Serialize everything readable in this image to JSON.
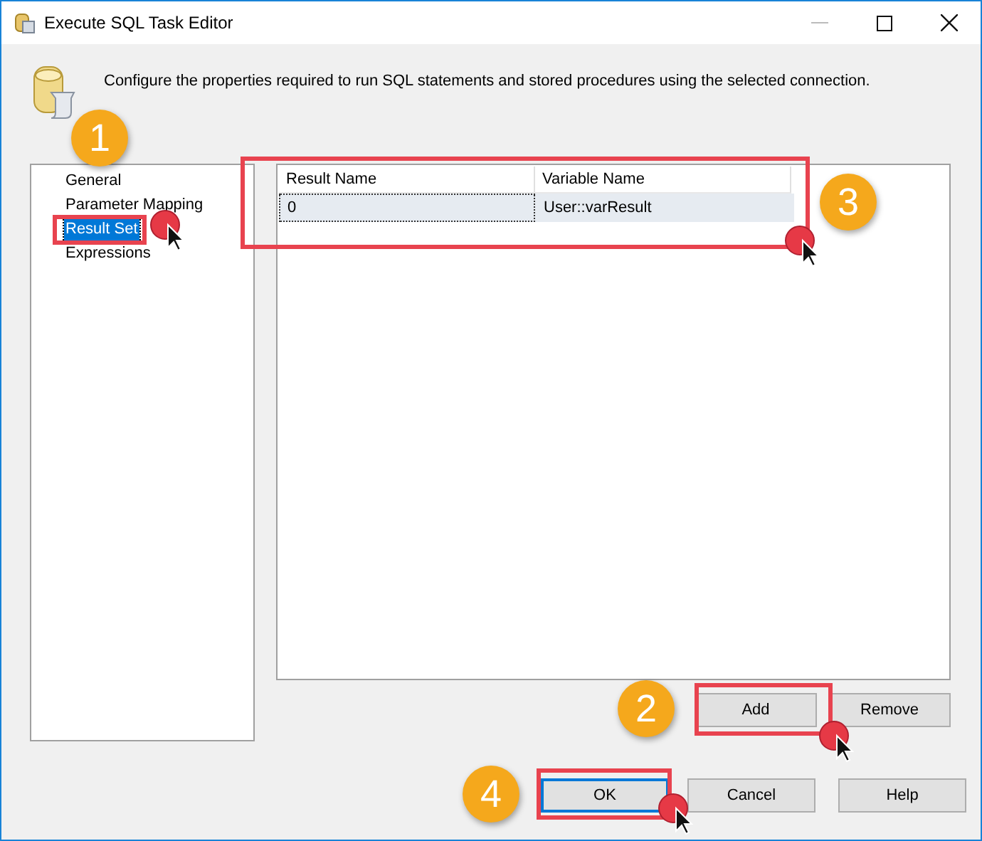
{
  "window": {
    "title": "Execute SQL Task Editor"
  },
  "description": "Configure the properties required to run SQL statements and stored procedures using the selected connection.",
  "sidebar": {
    "items": [
      {
        "label": "General",
        "selected": false
      },
      {
        "label": "Parameter Mapping",
        "selected": false
      },
      {
        "label": "Result Set",
        "selected": true
      },
      {
        "label": "Expressions",
        "selected": false
      }
    ]
  },
  "table": {
    "columns": [
      "Result Name",
      "Variable Name"
    ],
    "rows": [
      {
        "cells": [
          "0",
          "User::varResult"
        ],
        "selected": true
      }
    ]
  },
  "grid_buttons": [
    {
      "label": "Add",
      "default": false
    },
    {
      "label": "Remove",
      "default": false
    }
  ],
  "dialog_buttons": [
    {
      "label": "OK",
      "default": true
    },
    {
      "label": "Cancel",
      "default": false
    },
    {
      "label": "Help",
      "default": false
    }
  ],
  "callouts": [
    {
      "number": "1"
    },
    {
      "number": "2"
    },
    {
      "number": "3"
    },
    {
      "number": "4"
    }
  ]
}
